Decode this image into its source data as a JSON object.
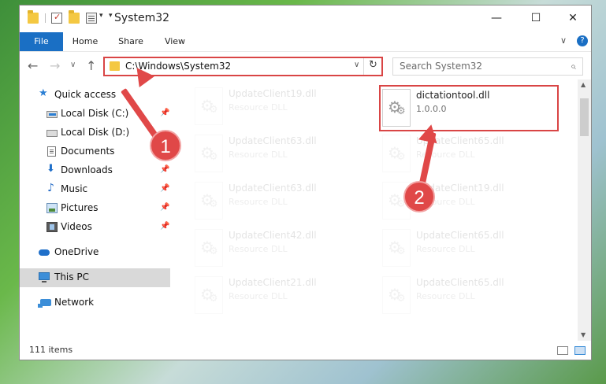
{
  "window": {
    "title": "System32"
  },
  "window_controls": {
    "minimize": "—",
    "maximize": "☐",
    "close": "✕"
  },
  "ribbon": {
    "tabs": [
      "File",
      "Home",
      "Share",
      "View"
    ],
    "collapse_glyph": "∨",
    "help_glyph": "?"
  },
  "nav_buttons": {
    "back": "←",
    "forward": "→",
    "recent": "∨",
    "up": "↑"
  },
  "address": {
    "path": "C:\\Windows\\System32",
    "dropdown": "∨",
    "refresh": "↻"
  },
  "search": {
    "placeholder": "Search System32",
    "icon": "⌕"
  },
  "navpane": {
    "items": [
      {
        "label": "Quick access",
        "icon": "star-icon"
      },
      {
        "label": "Local Disk (C:)",
        "icon": "drive-icon",
        "pinned": true
      },
      {
        "label": "Local Disk (D:)",
        "icon": "drive-icon"
      },
      {
        "label": "Documents",
        "icon": "documents-icon",
        "pinned": true
      },
      {
        "label": "Downloads",
        "icon": "downloads-icon",
        "pinned": true
      },
      {
        "label": "Music",
        "icon": "music-icon",
        "pinned": true
      },
      {
        "label": "Pictures",
        "icon": "pictures-icon",
        "pinned": true
      },
      {
        "label": "Videos",
        "icon": "videos-icon",
        "pinned": true
      },
      {
        "label": "OneDrive",
        "icon": "onedrive-icon"
      },
      {
        "label": "This PC",
        "icon": "this-pc-icon",
        "selected": true
      },
      {
        "label": "Network",
        "icon": "network-icon"
      }
    ],
    "pin_glyph": "📌"
  },
  "files": [
    {
      "name": "UpdateClient19.dll",
      "type": "Resource DLL",
      "faded": true
    },
    {
      "name": "dictationtool.dll",
      "type": "1.0.0.0",
      "faded": false
    },
    {
      "name": "UpdateClient63.dll",
      "type": "Resource DLL",
      "faded": true
    },
    {
      "name": "UpdateClient65.dll",
      "type": "Resource DLL",
      "faded": true
    },
    {
      "name": "UpdateClient63.dll",
      "type": "Resource DLL",
      "faded": true
    },
    {
      "name": "UpdateClient19.dll",
      "type": "Resource DLL",
      "faded": true
    },
    {
      "name": "UpdateClient42.dll",
      "type": "Resource DLL",
      "faded": true
    },
    {
      "name": "UpdateClient65.dll",
      "type": "Resource DLL",
      "faded": true
    },
    {
      "name": "UpdateClient21.dll",
      "type": "Resource DLL",
      "faded": true
    },
    {
      "name": "UpdateClient65.dll",
      "type": "Resource DLL",
      "faded": true
    }
  ],
  "status": {
    "item_count": "111 items"
  },
  "markers": {
    "step1": "1",
    "step2": "2"
  },
  "colors": {
    "accent": "#1a6fc4",
    "highlight": "#d94545",
    "selected": "#d9d9d9"
  }
}
